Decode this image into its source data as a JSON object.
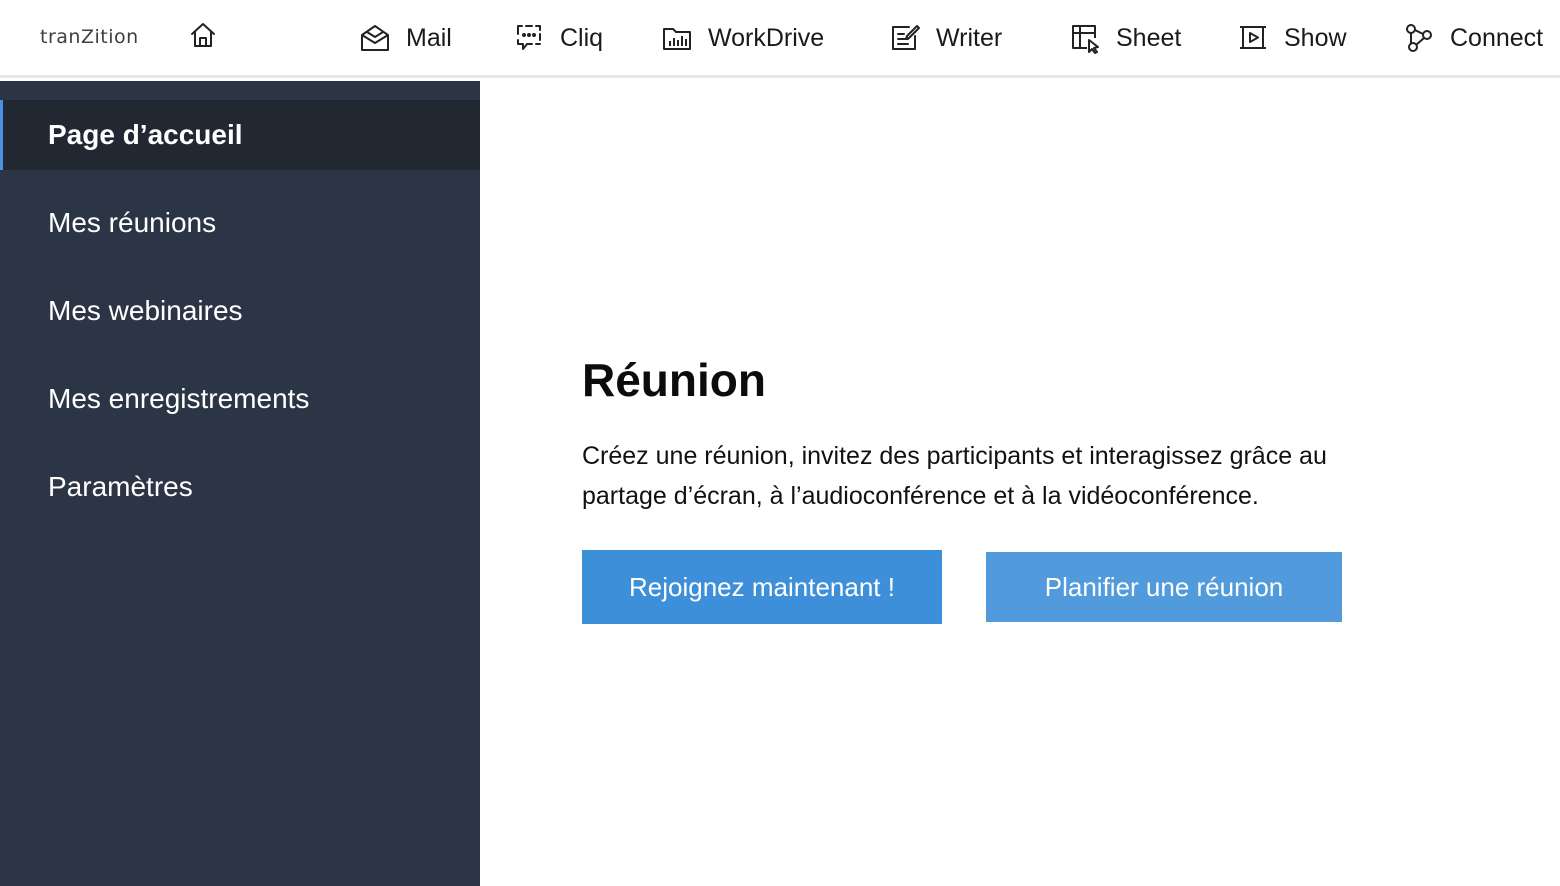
{
  "header": {
    "brand": "tranZition",
    "apps": [
      {
        "label": "Mail",
        "icon": "mail-icon"
      },
      {
        "label": "Cliq",
        "icon": "chat-icon"
      },
      {
        "label": "WorkDrive",
        "icon": "folder-chart-icon"
      },
      {
        "label": "Writer",
        "icon": "document-edit-icon"
      },
      {
        "label": "Sheet",
        "icon": "spreadsheet-icon"
      },
      {
        "label": "Show",
        "icon": "presentation-play-icon"
      },
      {
        "label": "Connect",
        "icon": "network-icon"
      }
    ]
  },
  "sidebar": {
    "items": [
      {
        "label": "Page d’accueil",
        "active": true
      },
      {
        "label": "Mes réunions",
        "active": false
      },
      {
        "label": "Mes webinaires",
        "active": false
      },
      {
        "label": "Mes enregistrements",
        "active": false
      },
      {
        "label": "Paramètres",
        "active": false
      }
    ]
  },
  "main": {
    "title": "Réunion",
    "description": "Créez une réunion, invitez des participants et interagissez grâce au partage d’écran, à l’audioconférence et à la vidéoconférence.",
    "join_button": "Rejoignez maintenant !",
    "schedule_button": "Planifier une réunion"
  },
  "colors": {
    "sidebar_bg": "#2b3545",
    "sidebar_active_bg": "#222832",
    "accent": "#4a90e2",
    "join_button_bg": "#3e8fd9",
    "schedule_button_bg": "#519bdc"
  }
}
